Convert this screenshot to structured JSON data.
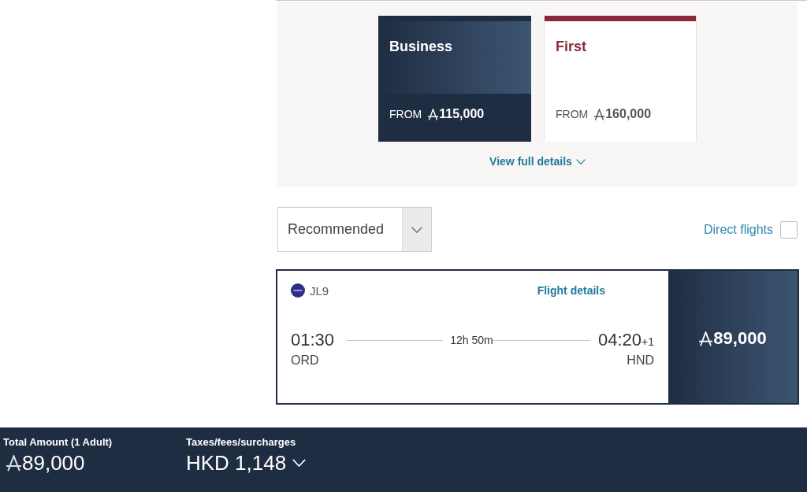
{
  "cabin_classes": [
    {
      "name": "Business",
      "from_label": "FROM",
      "price": "115,000",
      "color": "#1f2d42",
      "selected": true
    },
    {
      "name": "First",
      "from_label": "FROM",
      "price": "160,000",
      "color": "#8a2a3b",
      "selected": false
    }
  ],
  "view_full_details": "View full details",
  "sort": {
    "value": "Recommended"
  },
  "direct_flights": {
    "label": "Direct flights",
    "checked": false
  },
  "flights": [
    {
      "flight_number": "JL9",
      "details_link": "Flight details",
      "departure_time": "01:30",
      "departure_airport": "ORD",
      "duration": "12h 50m",
      "arrival_time": "04:20",
      "day_offset": "+1",
      "arrival_airport": "HND",
      "price": "89,000"
    }
  ],
  "footer": {
    "total_label": "Total Amount (1 Adult)",
    "total_price": "89,000",
    "taxes_label": "Taxes/fees/surcharges",
    "taxes_value": "HKD 1,148"
  }
}
